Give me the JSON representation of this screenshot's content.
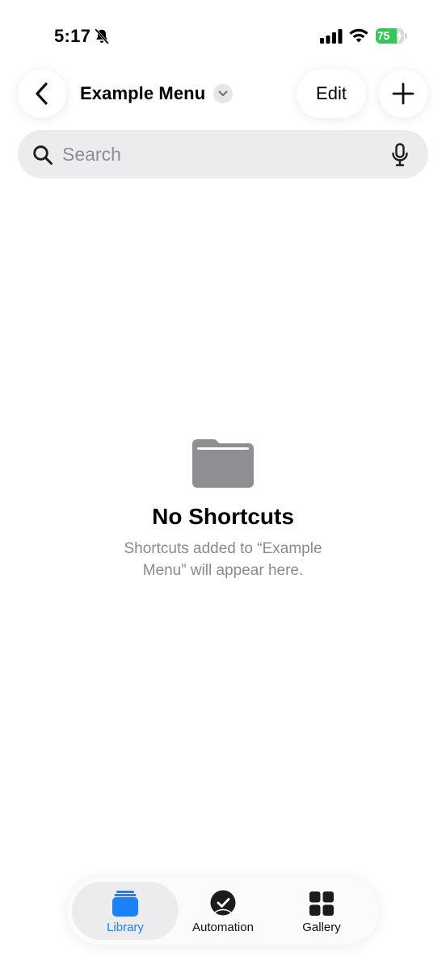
{
  "status_bar": {
    "time": "5:17",
    "battery_percent": "75",
    "battery_level": 0.75,
    "battery_color": "#34c759"
  },
  "nav": {
    "back_icon": "chevron-left-icon",
    "title": "Example Menu",
    "title_menu_icon": "chevron-down-icon",
    "edit_label": "Edit",
    "add_icon": "plus-icon"
  },
  "search": {
    "placeholder": "Search",
    "value": "",
    "icons": [
      "search-icon",
      "mic-icon"
    ]
  },
  "empty_state": {
    "icon": "folder-icon",
    "title": "No Shortcuts",
    "message": "Shortcuts added to “Example Menu” will appear here."
  },
  "tab_bar": {
    "accent": "#1a82f7",
    "tabs": [
      {
        "label": "Library",
        "icon": "library-icon",
        "selected": true
      },
      {
        "label": "Automation",
        "icon": "automation-icon",
        "selected": false
      },
      {
        "label": "Gallery",
        "icon": "gallery-icon",
        "selected": false
      }
    ]
  }
}
